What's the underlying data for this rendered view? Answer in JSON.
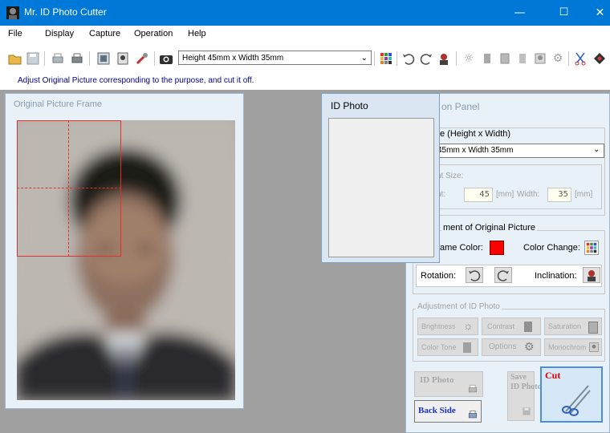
{
  "window": {
    "title": "Mr. ID Photo Cutter",
    "minimize": "—",
    "maximize": "☐",
    "close": "✕"
  },
  "menu": [
    "File",
    "Display",
    "Capture",
    "Operation",
    "Help"
  ],
  "toolbar": {
    "size_select": "Height 45mm x Width 35mm"
  },
  "info": "Adjust Original Picture corresponding to the purpose, and cut it off.",
  "original_frame": {
    "title": "Original Picture Frame"
  },
  "id_photo_window": {
    "title": "ID Photo"
  },
  "panel": {
    "title": "on Panel",
    "size_label": "e (Height x Width)",
    "size_value": "45mm x Width 35mm",
    "print_size_label": "nt Size:",
    "height_label": "ht:",
    "height_value": "45",
    "mm1": "[mm]",
    "width_label": "Width:",
    "width_value": "35",
    "mm2": "[mm]",
    "adj_orig_title": "ment of Original Picture",
    "frame_color_label": "ame Color:",
    "color_change_label": "Color Change:",
    "rotation_label": "Rotation:",
    "inclination_label": "Inclination:",
    "adj_id_title": "Adjustment of ID Photo",
    "brightness": "Brightness",
    "contrast": "Contrast",
    "saturation": "Saturation",
    "color_tone": "Color Tone",
    "options": "Options",
    "monochrome": "Monochrom",
    "id_photo_btn": "ID Photo",
    "save_btn_1": "Save",
    "save_btn_2": "ID Photo",
    "cut_btn": "Cut",
    "back_side_btn": "Back Side"
  },
  "colors": {
    "titlebar": "#0078d7",
    "frame_color": "#ff0000",
    "link_blue": "#000099"
  }
}
